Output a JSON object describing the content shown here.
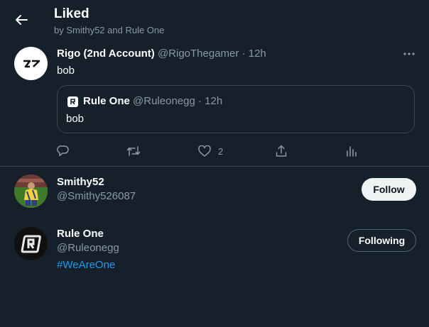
{
  "header": {
    "title": "Liked",
    "subtitle": "by Smithy52 and Rule One"
  },
  "tweet": {
    "author_name": "Rigo (2nd Account)",
    "author_handle": "@RigoThegamer",
    "separator": "·",
    "time": "12h",
    "text": "bob",
    "quote": {
      "author_name": "Rule One",
      "author_handle": "@Ruleonegg",
      "separator": "·",
      "time": "12h",
      "text": "bob"
    },
    "like_count": "2"
  },
  "users": [
    {
      "name": "Smithy52",
      "handle": "@Smithy526087",
      "button": "Follow"
    },
    {
      "name": "Rule One",
      "handle": "@Ruleonegg",
      "bio": "#WeAreOne",
      "button": "Following"
    }
  ],
  "icons": {
    "back": "arrow-left-icon",
    "more": "more-icon",
    "reply": "reply-icon",
    "retweet": "retweet-icon",
    "like": "heart-icon",
    "share": "share-icon",
    "analytics": "analytics-icon"
  },
  "colors": {
    "background": "#15202b",
    "border": "#38444d",
    "secondary_text": "#8b98a5",
    "link": "#1d9bf0"
  }
}
